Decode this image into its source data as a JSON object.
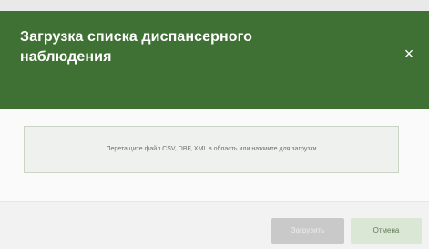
{
  "dialog": {
    "title_line1": "Загрузка списка диспансерного",
    "title_line2": "наблюдения",
    "close_icon": "close-icon",
    "close_glyph": "×"
  },
  "dropzone": {
    "text": "Перетащите файл CSV, DBF, XML в область или нажмите для загрузки"
  },
  "footer": {
    "upload_label": "Загрузить",
    "cancel_label": "Отмена"
  },
  "colors": {
    "header": "#3f7134",
    "primary_button_disabled": "#c9c9c9",
    "secondary_button": "#d9e7d4"
  }
}
